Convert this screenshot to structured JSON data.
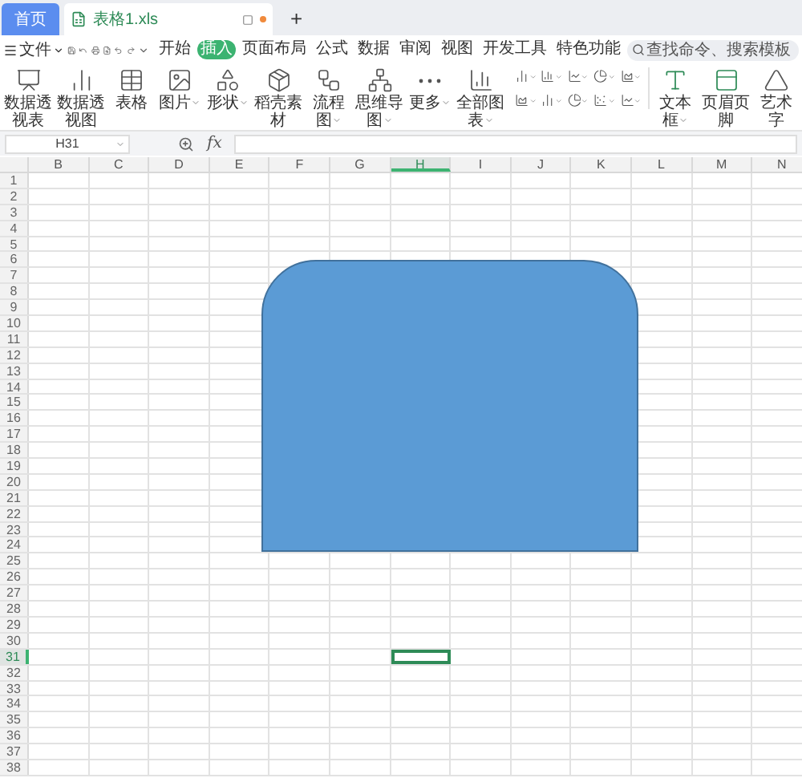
{
  "home_button": "首页",
  "tabs": [
    {
      "label": "表格1.xls",
      "selected": true
    }
  ],
  "new_tab": "+",
  "file_menu": "文件",
  "menu": [
    {
      "label": "开始",
      "selected": false
    },
    {
      "label": "插入",
      "selected": true
    },
    {
      "label": "页面布局",
      "selected": false
    },
    {
      "label": "公式",
      "selected": false
    },
    {
      "label": "数据",
      "selected": false
    },
    {
      "label": "审阅",
      "selected": false
    },
    {
      "label": "视图",
      "selected": false
    },
    {
      "label": "开发工具",
      "selected": false
    },
    {
      "label": "特色功能",
      "selected": false
    }
  ],
  "search": {
    "placeholder": "查找命令、搜索模板"
  },
  "ribbon": [
    {
      "label": "数据透视表",
      "caret": false
    },
    {
      "label": "数据透视图",
      "caret": false
    },
    {
      "label": "表格",
      "caret": false
    },
    {
      "label": "图片",
      "caret": true
    },
    {
      "label": "形状",
      "caret": true
    },
    {
      "label": "稻壳素材",
      "caret": false
    },
    {
      "label": "流程图",
      "caret": true
    },
    {
      "label": "思维导图",
      "caret": true
    },
    {
      "label": "更多",
      "caret": true
    },
    {
      "label": "全部图表",
      "caret": true
    },
    {
      "kind": "chart-grid"
    },
    {
      "label": "文本框",
      "caret": true
    },
    {
      "label": "页眉页脚",
      "caret": false
    },
    {
      "label": "艺术字",
      "caret": false
    }
  ],
  "name_box": "H31",
  "formula_label": "fx",
  "columns": [
    {
      "label": "B",
      "selected": false
    },
    {
      "label": "C",
      "selected": false
    },
    {
      "label": "D",
      "selected": false
    },
    {
      "label": "E",
      "selected": false
    },
    {
      "label": "F",
      "selected": false
    },
    {
      "label": "G",
      "selected": false
    },
    {
      "label": "H",
      "selected": true
    },
    {
      "label": "I",
      "selected": false
    },
    {
      "label": "J",
      "selected": false
    },
    {
      "label": "K",
      "selected": false
    },
    {
      "label": "L",
      "selected": false
    },
    {
      "label": "M",
      "selected": false
    },
    {
      "label": "N",
      "selected": false
    }
  ],
  "rows": [
    {
      "label": "1",
      "selected": false
    },
    {
      "label": "2",
      "selected": false
    },
    {
      "label": "3",
      "selected": false
    },
    {
      "label": "4",
      "selected": false
    },
    {
      "label": "5",
      "selected": false
    },
    {
      "label": "6",
      "selected": false
    },
    {
      "label": "7",
      "selected": false
    },
    {
      "label": "8",
      "selected": false
    },
    {
      "label": "9",
      "selected": false
    },
    {
      "label": "10",
      "selected": false
    },
    {
      "label": "11",
      "selected": false
    },
    {
      "label": "12",
      "selected": false
    },
    {
      "label": "13",
      "selected": false
    },
    {
      "label": "14",
      "selected": false
    },
    {
      "label": "15",
      "selected": false
    },
    {
      "label": "16",
      "selected": false
    },
    {
      "label": "17",
      "selected": false
    },
    {
      "label": "18",
      "selected": false
    },
    {
      "label": "19",
      "selected": false
    },
    {
      "label": "20",
      "selected": false
    },
    {
      "label": "21",
      "selected": false
    },
    {
      "label": "22",
      "selected": false
    },
    {
      "label": "23",
      "selected": false
    },
    {
      "label": "24",
      "selected": false
    },
    {
      "label": "25",
      "selected": false
    },
    {
      "label": "26",
      "selected": false
    },
    {
      "label": "27",
      "selected": false
    },
    {
      "label": "28",
      "selected": false
    },
    {
      "label": "29",
      "selected": false
    },
    {
      "label": "30",
      "selected": false
    },
    {
      "label": "31",
      "selected": true
    },
    {
      "label": "32",
      "selected": false
    },
    {
      "label": "33",
      "selected": false
    },
    {
      "label": "34",
      "selected": false
    },
    {
      "label": "35",
      "selected": false
    },
    {
      "label": "36",
      "selected": false
    },
    {
      "label": "37",
      "selected": false
    },
    {
      "label": "38",
      "selected": false
    }
  ],
  "shape": {
    "kind": "round-top-rectangle"
  }
}
